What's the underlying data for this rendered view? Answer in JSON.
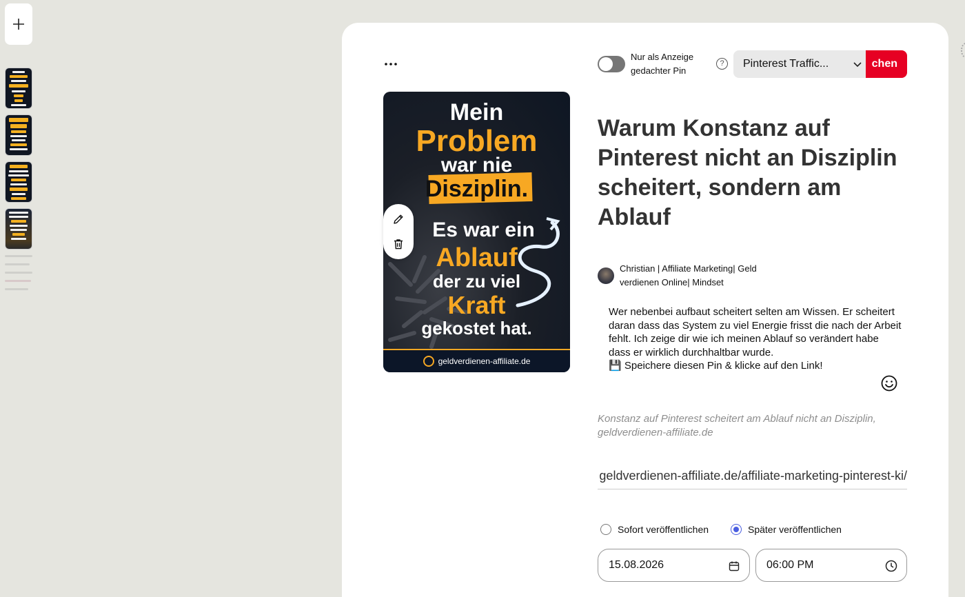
{
  "rail": {
    "add_label": "+",
    "thumbnails": [
      "Mein Problem war nie Disziplin",
      "40-90 EURO",
      "ZEHN E-MAIL-ABONNENTEN",
      "WENN ICH NOCH EINMAL BEI NULL STARTEN MÜSSTE"
    ]
  },
  "toolbar": {
    "more_label": "…",
    "toggle_label": "Nur als Anzeige gedachter Pin",
    "toggle_on": false,
    "help_label": "?",
    "board_select": "Pinterest Traffic...",
    "publish_label": "chen"
  },
  "pin_image": {
    "line1": "Mein",
    "line2": "Problem",
    "line3": "war nie",
    "line4": "Disziplin.",
    "line5": "Es war ein",
    "line6": "Ablauf",
    "line7": "der zu viel",
    "line8": "Kraft",
    "line9": "gekostet hat.",
    "footer": "geldverdienen-affiliate.de"
  },
  "pin": {
    "title": "Warum Konstanz auf Pinterest nicht an Disziplin scheitert, sondern am Ablauf",
    "author": "Christian | Affiliate Marketing| Geld verdienen Online| Mindset",
    "description": "Wer nebenbei aufbaut scheitert selten am Wissen. Er scheitert daran dass das System zu viel Energie frisst die nach der Arbeit fehlt. Ich zeige dir wie ich meinen Ablauf so verändert habe dass er wirklich durchhaltbar wurde.",
    "description_cta": "💾 Speichere diesen Pin & klicke auf den Link!",
    "alt_text": "Konstanz auf Pinterest scheitert am Ablauf nicht an Disziplin, geldverdienen-affiliate.de",
    "link": "geldverdienen-affiliate.de/affiliate-marketing-pinterest-ki/"
  },
  "schedule": {
    "option_now": "Sofort veröffentlichen",
    "option_later": "Später veröffentlichen",
    "selected": "later",
    "date": "15.08.2026",
    "time": "06:00 PM"
  },
  "colors": {
    "accent": "#e60023",
    "radio": "#4a5ee0",
    "pin_yellow": "#f7a823"
  }
}
